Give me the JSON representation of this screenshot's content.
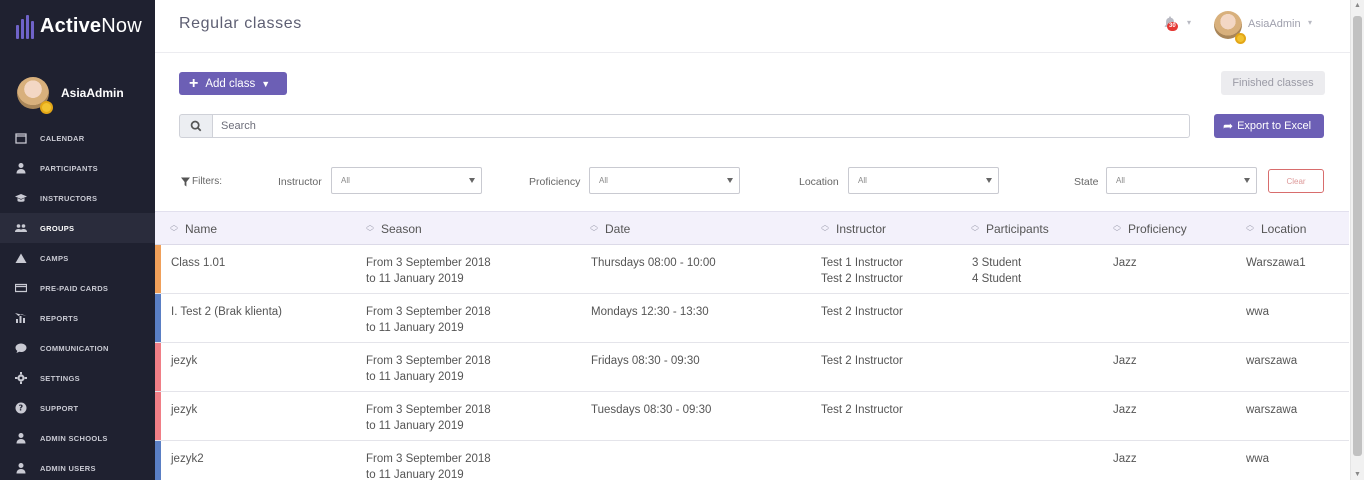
{
  "app": {
    "logo_bold": "Active",
    "logo_light": "Now"
  },
  "sidebar": {
    "user_name": "AsiaAdmin",
    "items": [
      {
        "label": "CALENDAR",
        "icon": "calendar-icon"
      },
      {
        "label": "PARTICIPANTS",
        "icon": "person-icon"
      },
      {
        "label": "INSTRUCTORS",
        "icon": "graduation-cap-icon"
      },
      {
        "label": "GROUPS",
        "icon": "group-icon",
        "active": true
      },
      {
        "label": "CAMPS",
        "icon": "tent-icon"
      },
      {
        "label": "PRE-PAID CARDS",
        "icon": "card-icon"
      },
      {
        "label": "REPORTS",
        "icon": "bar-chart-icon"
      },
      {
        "label": "COMMUNICATION",
        "icon": "chat-icon"
      },
      {
        "label": "SETTINGS",
        "icon": "gear-icon"
      },
      {
        "label": "SUPPORT",
        "icon": "help-icon"
      },
      {
        "label": "ADMIN SCHOOLS",
        "icon": "person-icon"
      },
      {
        "label": "ADMIN USERS",
        "icon": "person-icon"
      }
    ]
  },
  "header": {
    "title": "Regular classes",
    "notifications_count": "30",
    "user_name": "AsiaAdmin"
  },
  "toolbar": {
    "add_class_label": "Add class",
    "finished_classes_label": "Finished classes",
    "search_placeholder": "Search",
    "export_label": "Export to Excel"
  },
  "filters": {
    "label": "Filters:",
    "instructor": {
      "label": "Instructor",
      "value": "All"
    },
    "proficiency": {
      "label": "Proficiency",
      "value": "All"
    },
    "location": {
      "label": "Location",
      "value": "All"
    },
    "state": {
      "label": "State",
      "value": "All"
    },
    "clear_label": "Clear"
  },
  "table": {
    "columns": [
      "Name",
      "Season",
      "Date",
      "Instructor",
      "Participants",
      "Proficiency",
      "Location"
    ],
    "rows": [
      {
        "color": "#f0a05a",
        "name": "Class 1.01",
        "season": [
          "From 3 September 2018",
          "to 11 January 2019"
        ],
        "date": "Thursdays 08:00 - 10:00",
        "instructor": [
          "Test 1 Instructor",
          "Test 2 Instructor"
        ],
        "participants": [
          "3 Student",
          "4 Student"
        ],
        "proficiency": "Jazz",
        "location": "Warszawa1"
      },
      {
        "color": "#5a7fc4",
        "name": "I. Test 2 (Brak klienta)",
        "season": [
          "From 3 September 2018",
          "to 11 January 2019"
        ],
        "date": "Mondays 12:30 - 13:30",
        "instructor": [
          "Test 2 Instructor"
        ],
        "participants": [],
        "proficiency": "",
        "location": "wwa"
      },
      {
        "color": "#f07e86",
        "name": "jezyk",
        "season": [
          "From 3 September 2018",
          "to 11 January 2019"
        ],
        "date": "Fridays 08:30 - 09:30",
        "instructor": [
          "Test 2 Instructor"
        ],
        "participants": [],
        "proficiency": "Jazz",
        "location": "warszawa"
      },
      {
        "color": "#f07e86",
        "name": "jezyk",
        "season": [
          "From 3 September 2018",
          "to 11 January 2019"
        ],
        "date": "Tuesdays 08:30 - 09:30",
        "instructor": [
          "Test 2 Instructor"
        ],
        "participants": [],
        "proficiency": "Jazz",
        "location": "warszawa"
      },
      {
        "color": "#5a7fc4",
        "name": "jezyk2",
        "season": [
          "From 3 September 2018",
          "to 11 January 2019"
        ],
        "date": "",
        "instructor": [],
        "participants": [],
        "proficiency": "Jazz",
        "location": "wwa"
      }
    ]
  }
}
